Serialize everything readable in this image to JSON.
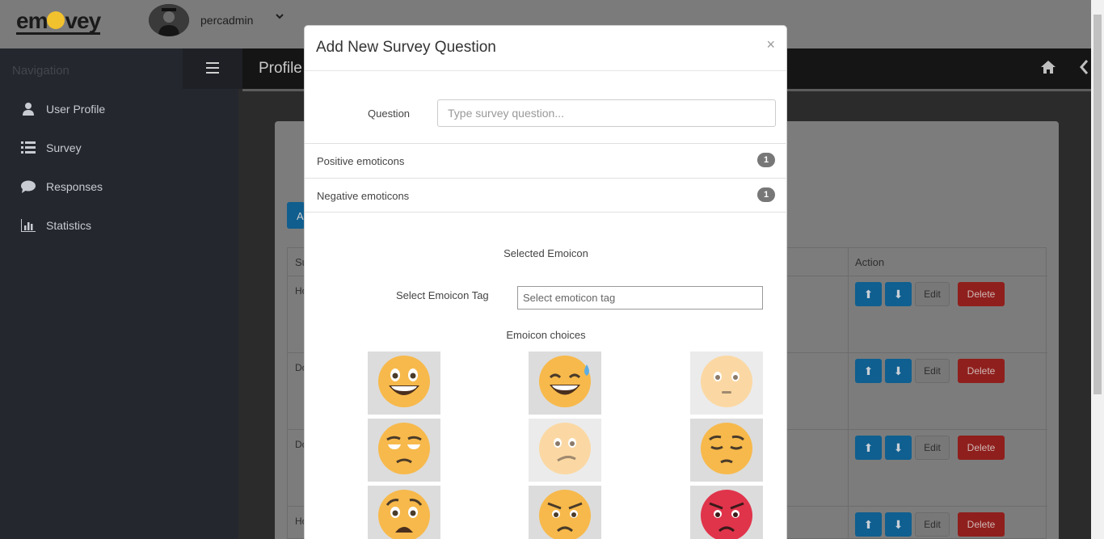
{
  "app": {
    "logo_text": "emovey",
    "username": "percadmin"
  },
  "sidebar": {
    "heading": "Navigation",
    "items": [
      {
        "label": "User Profile",
        "icon": "user-icon"
      },
      {
        "label": "Survey",
        "icon": "list-icon"
      },
      {
        "label": "Responses",
        "icon": "speech-bubble-icon"
      },
      {
        "label": "Statistics",
        "icon": "bar-chart-icon"
      }
    ]
  },
  "header": {
    "title": "Profile"
  },
  "table": {
    "col_first_partial": "Su",
    "col_action": "Action",
    "rows": [
      {
        "first_partial": "Ho"
      },
      {
        "first_partial": "Do"
      },
      {
        "first_partial": "Do"
      },
      {
        "first_partial": "Ho"
      }
    ],
    "edit_label": "Edit",
    "delete_label": "Delete"
  },
  "add_button_partial": "A",
  "modal": {
    "title": "Add New Survey Question",
    "close": "×",
    "question_label": "Question",
    "question_placeholder": "Type survey question...",
    "groups": [
      {
        "label": "Positive emoticons",
        "count": "1"
      },
      {
        "label": "Negative emoticons",
        "count": "1"
      }
    ],
    "selected_title": "Selected Emoicon",
    "tag_label": "Select Emoicon Tag",
    "tag_placeholder": "Select emoticon tag",
    "choices_title": "Emoicon choices",
    "emoticons": [
      "grinning-face-icon",
      "grinning-sweat-face-icon",
      "neutral-face-icon",
      "unamused-face-icon",
      "confused-face-icon",
      "pensive-face-icon",
      "worried-face-icon",
      "angry-face-icon",
      "pouting-face-icon"
    ]
  },
  "colors": {
    "accent": "#1a7bbf",
    "danger": "#c9302c",
    "badge": "#777777"
  }
}
